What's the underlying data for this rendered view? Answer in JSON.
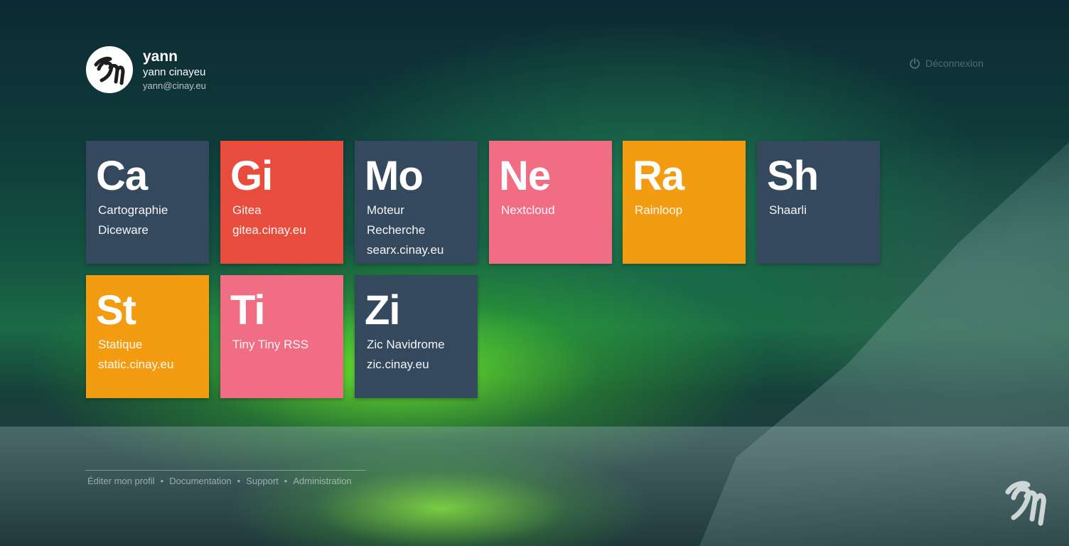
{
  "user": {
    "login": "yann",
    "fullname": "yann cinayeu",
    "email": "yann@cinay.eu"
  },
  "logout": {
    "label": "Déconnexion",
    "icon": "power-icon"
  },
  "tiles": [
    {
      "abbr": "Ca",
      "lines": [
        "Cartographie",
        "Diceware"
      ],
      "color": "#34495e"
    },
    {
      "abbr": "Gi",
      "lines": [
        "Gitea",
        "gitea.cinay.eu"
      ],
      "color": "#e74c3c"
    },
    {
      "abbr": "Mo",
      "lines": [
        "Moteur",
        "Recherche",
        "searx.cinay.eu"
      ],
      "color": "#34495e"
    },
    {
      "abbr": "Ne",
      "lines": [
        "Nextcloud"
      ],
      "color": "#f16d84"
    },
    {
      "abbr": "Ra",
      "lines": [
        "Rainloop"
      ],
      "color": "#f39c12"
    },
    {
      "abbr": "Sh",
      "lines": [
        "Shaarli"
      ],
      "color": "#34495e"
    },
    {
      "abbr": "St",
      "lines": [
        "Statique",
        "static.cinay.eu"
      ],
      "color": "#f39c12"
    },
    {
      "abbr": "Ti",
      "lines": [
        "Tiny Tiny RSS"
      ],
      "color": "#f16d84"
    },
    {
      "abbr": "Zi",
      "lines": [
        "Zic Navidrome",
        "zic.cinay.eu"
      ],
      "color": "#34495e"
    }
  ],
  "footer": {
    "links": [
      "Éditer mon profil",
      "Documentation",
      "Support",
      "Administration"
    ],
    "separator": "•"
  }
}
